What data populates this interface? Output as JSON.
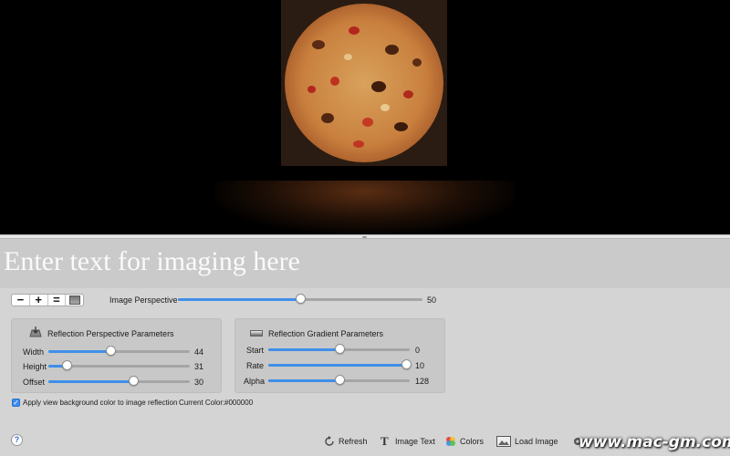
{
  "text_input": {
    "placeholder": "Enter text for imaging here",
    "value": ""
  },
  "zoom": {
    "minus": "−",
    "plus": "+",
    "equal": "=",
    "image_icon": "image-icon"
  },
  "image_perspective": {
    "label": "Image Perspective",
    "value": "50",
    "fraction": 0.5
  },
  "reflection_perspective": {
    "title": "Reflection Perspective Parameters",
    "params": [
      {
        "label": "Width",
        "value": "44",
        "fraction": 0.44
      },
      {
        "label": "Height",
        "value": "31",
        "fraction": 0.13
      },
      {
        "label": "Offset",
        "value": "30",
        "fraction": 0.6
      }
    ]
  },
  "reflection_gradient": {
    "title": "Reflection Gradient Parameters",
    "params": [
      {
        "label": "Start",
        "value": "0",
        "fraction": 0.5
      },
      {
        "label": "Rate",
        "value": "10",
        "fraction": 1.0
      },
      {
        "label": "Alpha",
        "value": "128",
        "fraction": 0.5
      }
    ]
  },
  "apply_bg": {
    "label": "Apply view background color to image reflection",
    "checked": true
  },
  "current_color": {
    "label": "Current Color:",
    "value": "#000000"
  },
  "toolbar": {
    "help": "?",
    "refresh": "Refresh",
    "image_text": "Image Text",
    "colors": "Colors",
    "load_image": "Load Image"
  },
  "watermark": "www.mac-gm.com",
  "colors": {
    "accent": "#3f8fe8",
    "background": "#000000"
  }
}
